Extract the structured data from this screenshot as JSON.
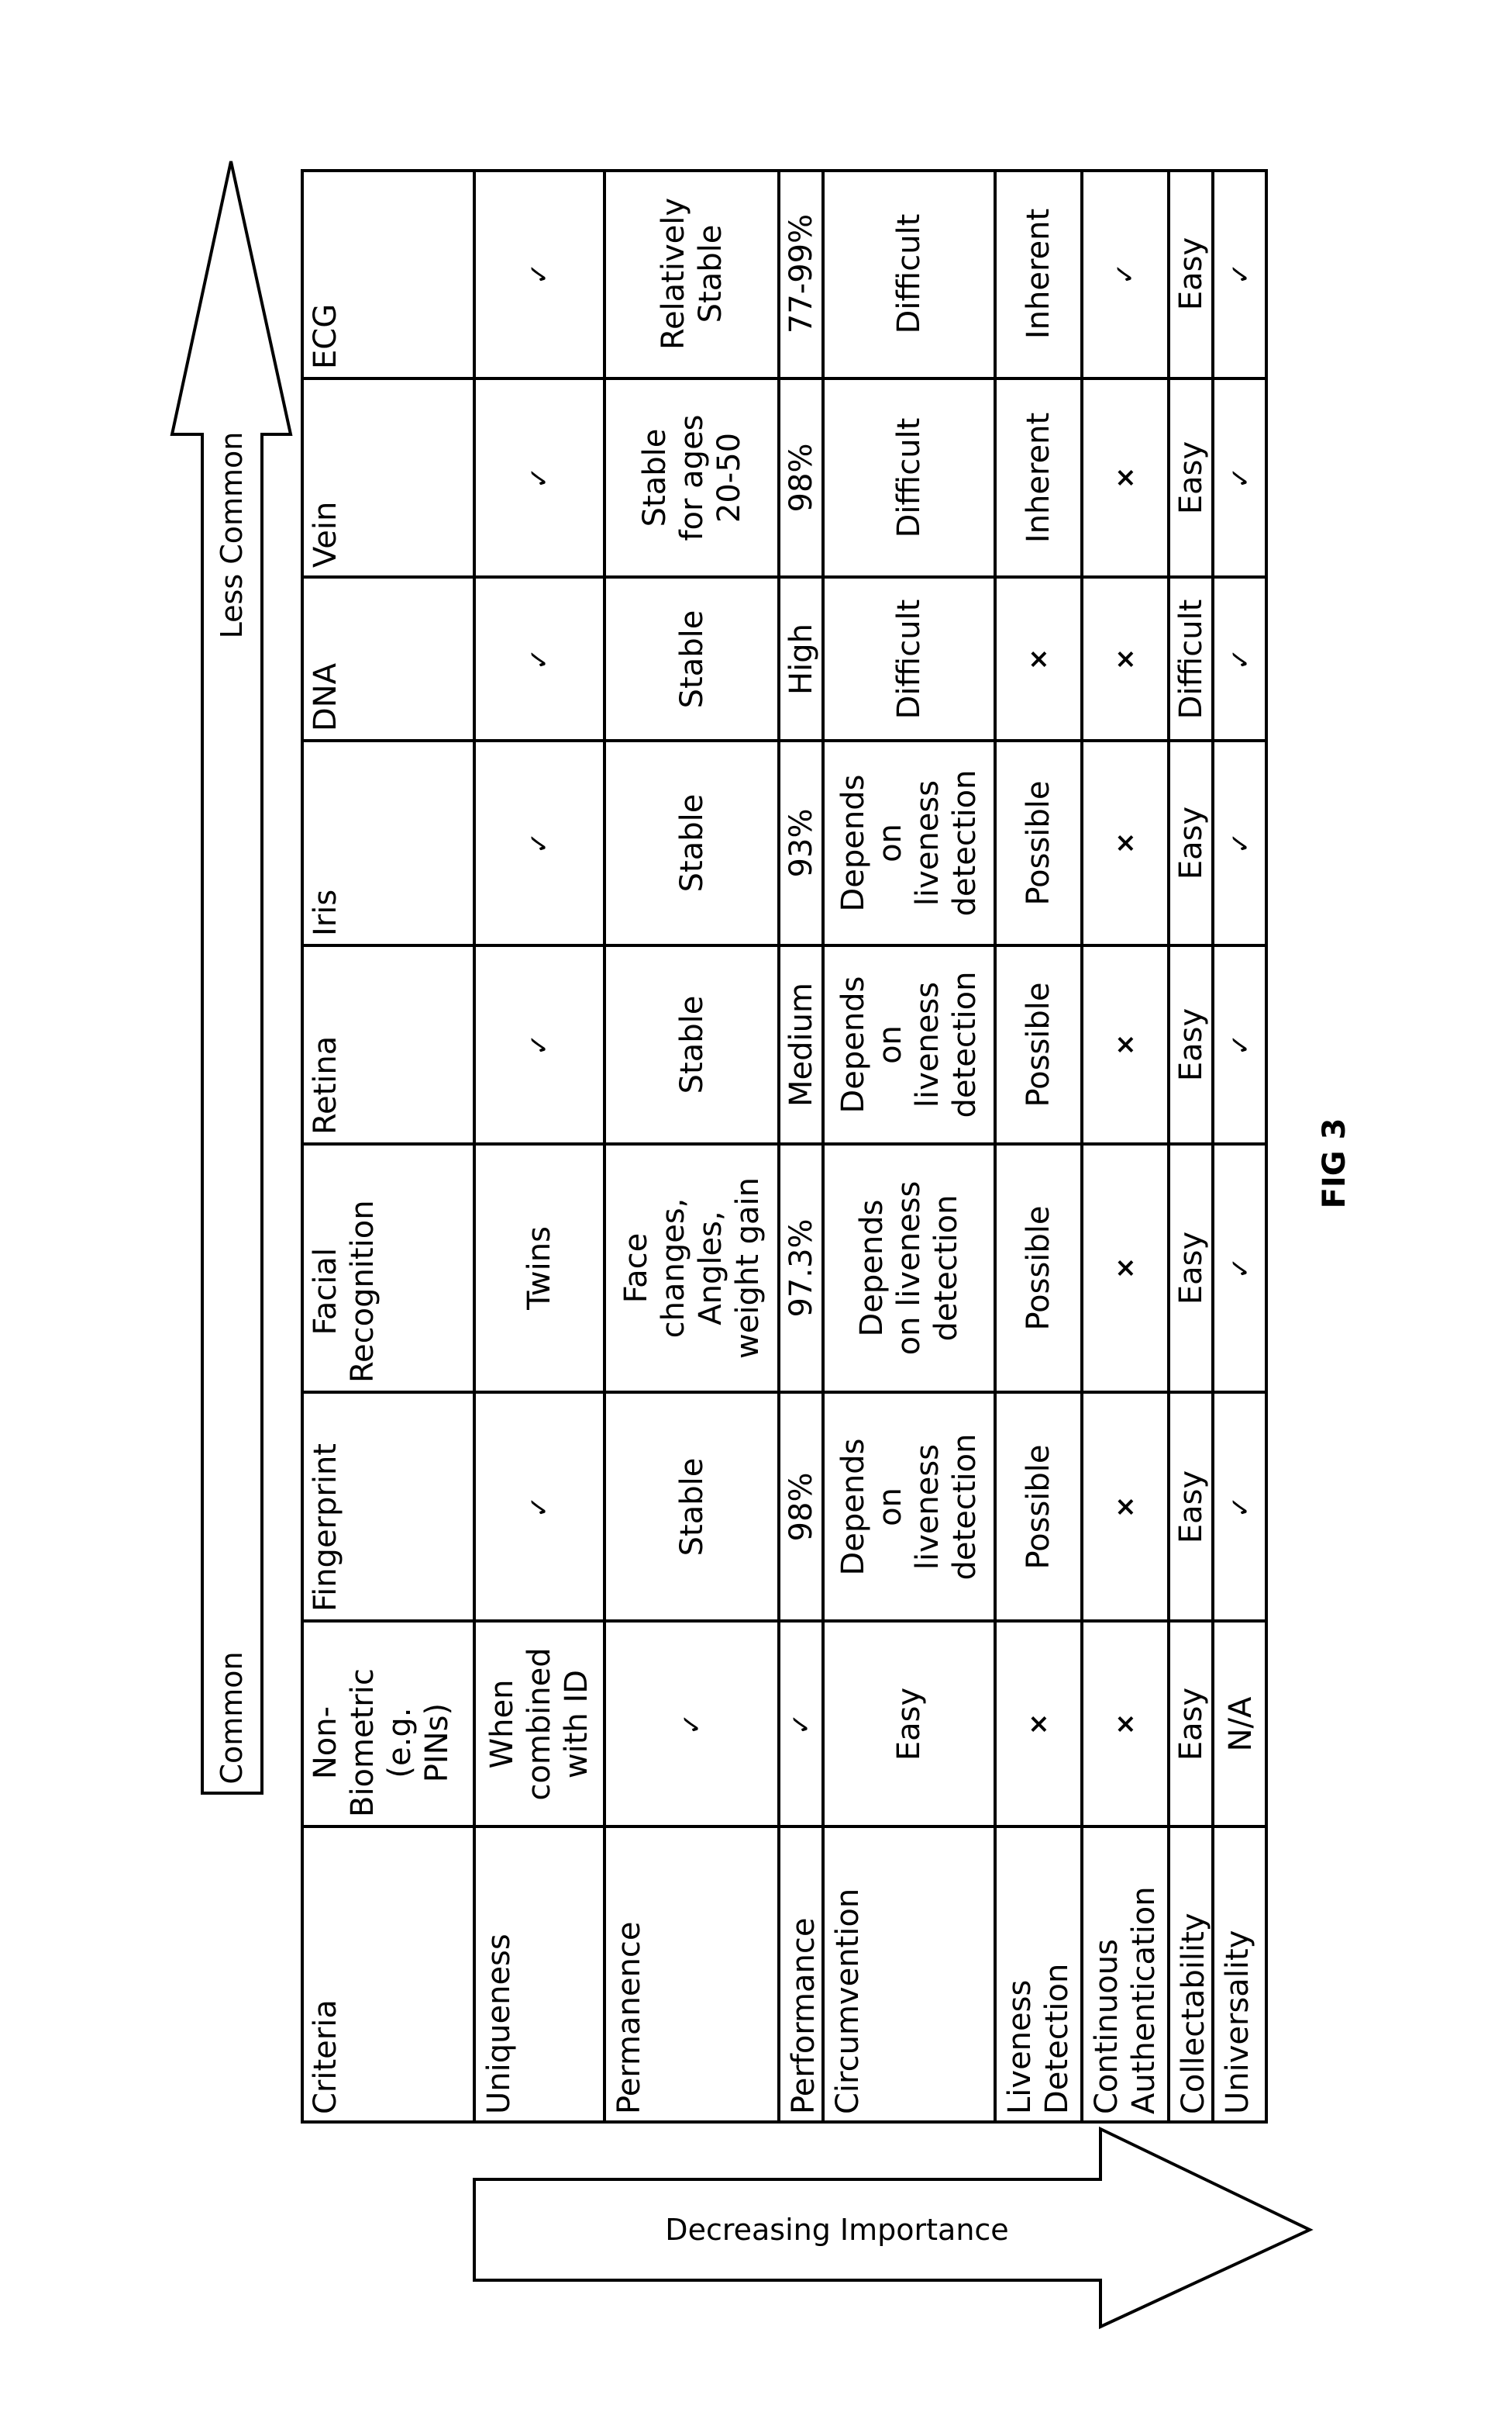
{
  "figure": {
    "label": "FIG 3",
    "arrows": {
      "commonality": {
        "start_label": "Common",
        "end_label": "Less Common"
      },
      "importance": {
        "label": "Decreasing Importance"
      }
    }
  },
  "table": {
    "columns": [
      "Criteria",
      "Non-\nBiometric\n(e.g.\nPINs)",
      "Fingerprint",
      "Facial\nRecognition",
      "Retina",
      "Iris",
      "DNA",
      "Vein",
      "ECG"
    ],
    "rows": [
      {
        "criterion": "Uniqueness",
        "values": [
          "When\ncombined\nwith ID",
          "✓",
          "Twins",
          "✓",
          "✓",
          "✓",
          "✓",
          "✓"
        ]
      },
      {
        "criterion": "Permanence",
        "values": [
          "✓",
          "Stable",
          "Face\nchanges,\nAngles,\nweight gain",
          "Stable",
          "Stable",
          "Stable",
          "Stable\nfor ages\n20-50",
          "Relatively\nStable"
        ]
      },
      {
        "criterion": "Performance",
        "values": [
          "✓",
          "98%",
          "97.3%",
          "Medium",
          "93%",
          "High",
          "98%",
          "77-99%"
        ]
      },
      {
        "criterion": "Circumvention",
        "values": [
          "Easy",
          "Depends\non\nliveness\ndetection",
          "Depends\non liveness\ndetection",
          "Depends\non\nliveness\ndetection",
          "Depends\non\nliveness\ndetection",
          "Difficult",
          "Difficult",
          "Difficult"
        ]
      },
      {
        "criterion": "Liveness\nDetection",
        "values": [
          "×",
          "Possible",
          "Possible",
          "Possible",
          "Possible",
          "×",
          "Inherent",
          "Inherent"
        ]
      },
      {
        "criterion": "Continuous\nAuthentication",
        "values": [
          "×",
          "×",
          "×",
          "×",
          "×",
          "×",
          "×",
          "✓"
        ]
      },
      {
        "criterion": "Collectability",
        "values": [
          "Easy",
          "Easy",
          "Easy",
          "Easy",
          "Easy",
          "Difficult",
          "Easy",
          "Easy"
        ]
      },
      {
        "criterion": "Universality",
        "values": [
          "N/A",
          "✓",
          "✓",
          "✓",
          "✓",
          "✓",
          "✓",
          "✓"
        ]
      }
    ]
  }
}
